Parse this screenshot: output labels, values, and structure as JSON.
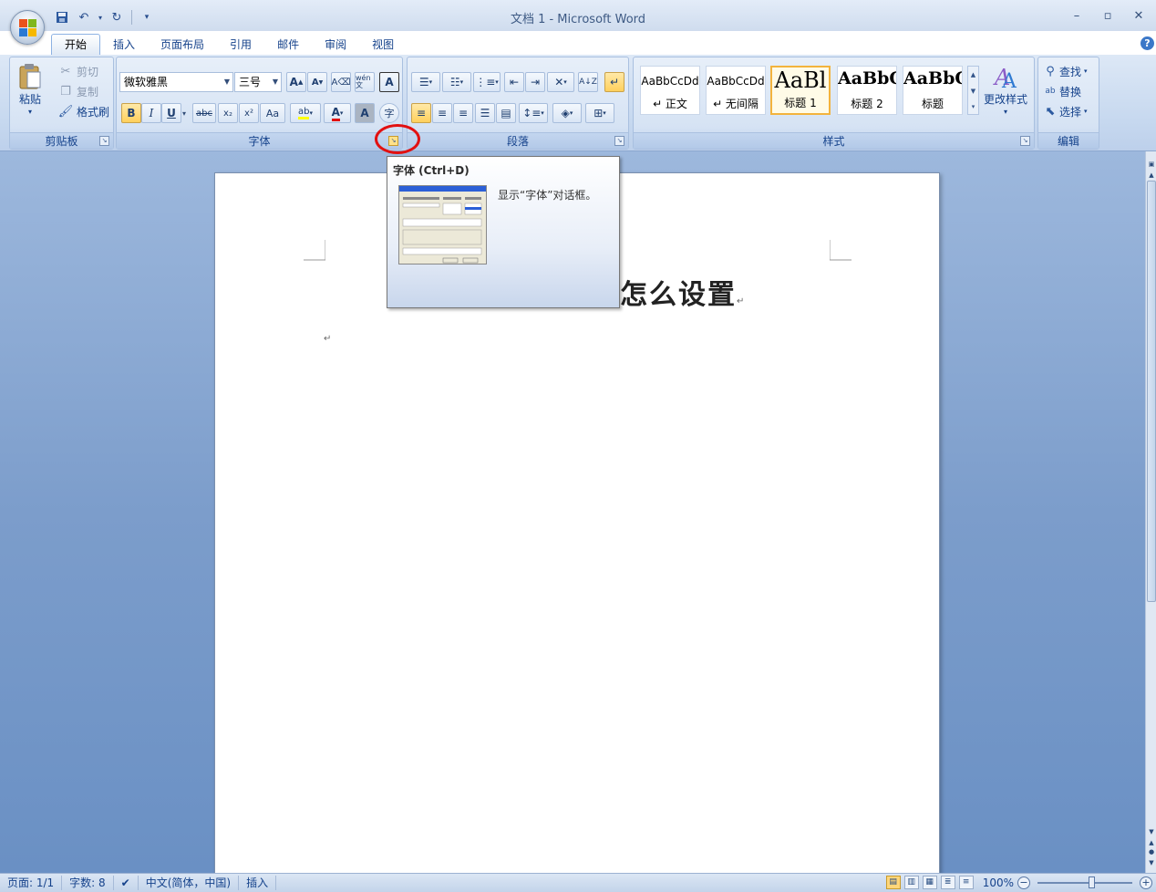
{
  "window": {
    "title": "文档 1 - Microsoft Word",
    "minimize": "–",
    "maximize": "▫",
    "close": "✕"
  },
  "quick_access": {
    "save_icon": "save-icon",
    "undo_icon": "undo-icon",
    "redo_icon": "redo-icon"
  },
  "tabs": [
    {
      "label": "开始",
      "active": true
    },
    {
      "label": "插入"
    },
    {
      "label": "页面布局"
    },
    {
      "label": "引用"
    },
    {
      "label": "邮件"
    },
    {
      "label": "审阅"
    },
    {
      "label": "视图"
    }
  ],
  "help": "?",
  "clipboard": {
    "group_label": "剪贴板",
    "paste": "粘贴",
    "cut": "剪切",
    "copy": "复制",
    "format_painter": "格式刷"
  },
  "font": {
    "group_label": "字体",
    "font_name": "微软雅黑",
    "font_size": "三号",
    "grow": "A",
    "shrink": "A",
    "bold": "B",
    "italic": "I",
    "underline": "U",
    "strike": "abc",
    "subscript": "x₂",
    "superscript": "x²",
    "change_case": "Aa",
    "phonetic": "wén 文"
  },
  "paragraph": {
    "group_label": "段落"
  },
  "styles": {
    "group_label": "样式",
    "items": [
      {
        "sample": "AaBbCcDd",
        "name": "↵ 正文"
      },
      {
        "sample": "AaBbCcDd",
        "name": "↵ 无间隔"
      },
      {
        "sample": "AaBl",
        "name": "标题 1",
        "selected": true
      },
      {
        "sample": "AaBbC",
        "name": "标题 2"
      },
      {
        "sample": "AaBbC",
        "name": "标题"
      }
    ],
    "change_styles": "更改样式"
  },
  "editing": {
    "group_label": "编辑",
    "find": "查找",
    "replace": "替换",
    "select": "选择"
  },
  "tooltip": {
    "title": "字体 (Ctrl+D)",
    "description": "显示“字体”对话框。"
  },
  "document": {
    "heading_visible": "怎么设置",
    "para_mark": "↵"
  },
  "status": {
    "page": "页面: 1/1",
    "words": "字数: 8",
    "language": "中文(简体，中国)",
    "mode": "插入",
    "zoom": "100%"
  }
}
